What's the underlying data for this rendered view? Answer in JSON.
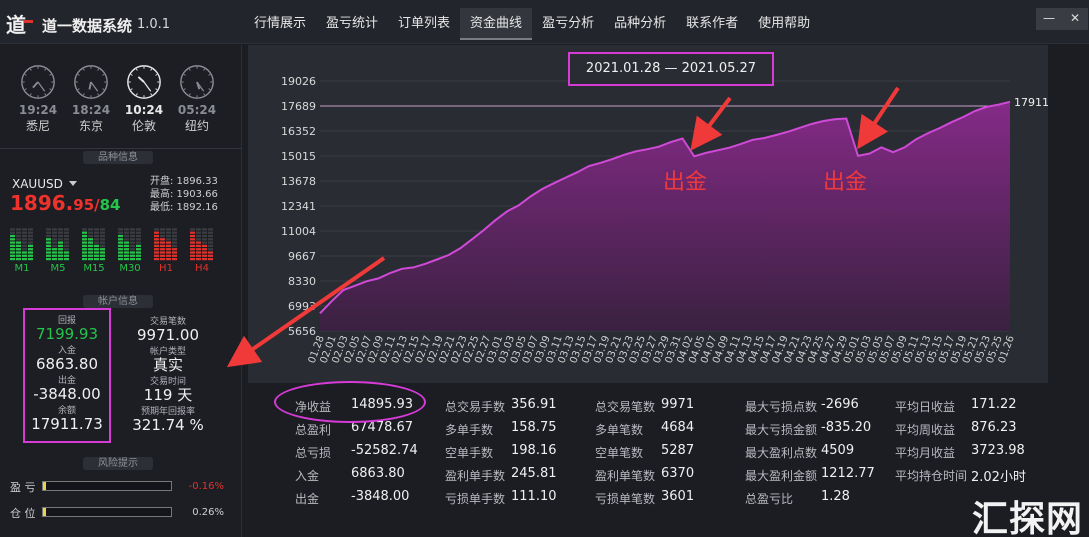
{
  "app": {
    "title": "道一数据系统",
    "version": "1.0.1"
  },
  "tabs": [
    {
      "label": "行情展示",
      "active": false
    },
    {
      "label": "盈亏统计",
      "active": false
    },
    {
      "label": "订单列表",
      "active": false
    },
    {
      "label": "资金曲线",
      "active": true
    },
    {
      "label": "盈亏分析",
      "active": false
    },
    {
      "label": "品种分析",
      "active": false
    },
    {
      "label": "联系作者",
      "active": false
    },
    {
      "label": "使用帮助",
      "active": false
    }
  ],
  "window": {
    "minimize": "—",
    "close": "✕"
  },
  "clocks": [
    {
      "time": "19:24",
      "city": "悉尼",
      "active": false,
      "hour": 19,
      "minute": 24
    },
    {
      "time": "18:24",
      "city": "东京",
      "active": false,
      "hour": 18,
      "minute": 24
    },
    {
      "time": "10:24",
      "city": "伦敦",
      "active": true,
      "hour": 10,
      "minute": 24
    },
    {
      "time": "05:24",
      "city": "纽约",
      "active": false,
      "hour": 5,
      "minute": 24
    }
  ],
  "symbol_info": {
    "section": "品种信息",
    "symbol": "XAUUSD",
    "price_int": "1896.",
    "price_dec": "95",
    "sep": "/",
    "price_sub": "84",
    "open": "开盘: 1896.33",
    "high": "最高: 1903.66",
    "low": "最低: 1892.16",
    "timeframes": [
      {
        "label": "M1",
        "color": "#25c44a",
        "levels": [
          0.8,
          0.55,
          0.3,
          0.45
        ]
      },
      {
        "label": "M5",
        "color": "#25c44a",
        "levels": [
          0.7,
          0.4,
          0.6,
          0.25
        ]
      },
      {
        "label": "M15",
        "color": "#25c44a",
        "levels": [
          0.85,
          0.65,
          0.5,
          0.35
        ]
      },
      {
        "label": "M30",
        "color": "#25c44a",
        "levels": [
          0.75,
          0.6,
          0.3,
          0.5
        ]
      },
      {
        "label": "H1",
        "color": "#e0322c",
        "levels": [
          0.9,
          0.7,
          0.55,
          0.4
        ]
      },
      {
        "label": "H4",
        "color": "#e0322c",
        "levels": [
          0.85,
          0.6,
          0.45,
          0.3
        ]
      }
    ]
  },
  "account": {
    "section": "帐户信息",
    "return_label": "回报",
    "return_value": "7199.93",
    "deposit_label": "入金",
    "deposit_value": "6863.80",
    "withdraw_label": "出金",
    "withdraw_value": "-3848.00",
    "balance_label": "余额",
    "balance_value": "17911.73",
    "trades_label": "交易笔数",
    "trades_value": "9971.00",
    "type_label": "帐户类型",
    "type_value": "真实",
    "time_label": "交易时间",
    "time_value": "119 天",
    "annual_label": "预期年回报率",
    "annual_value": "321.74 %"
  },
  "risk": {
    "section": "风险提示",
    "pl_label": "盈  亏",
    "pl_value": "-0.16%",
    "pos_label": "仓  位",
    "pos_value": "0.26%",
    "pos_fill": 0.0026
  },
  "chart_data": {
    "type": "area",
    "title": "2021.01.28 — 2021.05.27",
    "y_ticks": [
      "19026",
      "17689",
      "16352",
      "15015",
      "13678",
      "12341",
      "11004",
      "9667",
      "8330",
      "6993",
      "5656"
    ],
    "ylim": [
      5656,
      19026
    ],
    "x_ticks": [
      "01.28",
      "02.01",
      "02.03",
      "02.05",
      "02.07",
      "02.09",
      "02.11",
      "02.13",
      "02.15",
      "02.17",
      "02.19",
      "02.21",
      "02.23",
      "02.25",
      "02.27",
      "03.01",
      "03.03",
      "03.05",
      "03.07",
      "03.09",
      "03.11",
      "03.13",
      "03.15",
      "03.17",
      "03.19",
      "03.21",
      "03.23",
      "03.25",
      "03.27",
      "03.29",
      "03.31",
      "04.02",
      "04.05",
      "04.07",
      "04.09",
      "04.11",
      "04.13",
      "04.15",
      "04.17",
      "04.19",
      "04.21",
      "04.23",
      "04.25",
      "04.27",
      "04.29",
      "05.01",
      "05.03",
      "05.05",
      "05.07",
      "05.09",
      "05.11",
      "05.13",
      "05.15",
      "05.17",
      "05.19",
      "05.21",
      "05.23",
      "05.25",
      "01.26"
    ],
    "last_value_label": "17911.73",
    "reference_line": 17689,
    "values": [
      6600,
      7250,
      7850,
      8080,
      8320,
      8470,
      8760,
      8980,
      9060,
      9250,
      9480,
      9720,
      10080,
      10560,
      11050,
      11580,
      12050,
      12380,
      12850,
      13250,
      13560,
      13860,
      14150,
      14480,
      14650,
      14850,
      15080,
      15260,
      15380,
      15520,
      15760,
      15950,
      15000,
      15180,
      15320,
      15460,
      15660,
      15880,
      15980,
      16140,
      16310,
      16520,
      16720,
      16880,
      16980,
      17020,
      15020,
      15150,
      15480,
      15220,
      15480,
      15920,
      16240,
      16510,
      16820,
      17100,
      17420,
      17640,
      17760,
      17911
    ],
    "annotations": [
      "出金",
      "出金"
    ]
  },
  "stats": [
    [
      {
        "k": "净收益",
        "v": "14895.93"
      },
      {
        "k": "总盈利",
        "v": "67478.67"
      },
      {
        "k": "总亏损",
        "v": "-52582.74"
      },
      {
        "k": "入金",
        "v": "6863.80"
      },
      {
        "k": "出金",
        "v": "-3848.00"
      }
    ],
    [
      {
        "k": "总交易手数",
        "v": "356.91"
      },
      {
        "k": "多单手数",
        "v": "158.75"
      },
      {
        "k": "空单手数",
        "v": "198.16"
      },
      {
        "k": "盈利单手数",
        "v": "245.81"
      },
      {
        "k": "亏损单手数",
        "v": "111.10"
      }
    ],
    [
      {
        "k": "总交易笔数",
        "v": "9971"
      },
      {
        "k": "多单笔数",
        "v": "4684"
      },
      {
        "k": "空单笔数",
        "v": "5287"
      },
      {
        "k": "盈利单笔数",
        "v": "6370"
      },
      {
        "k": "亏损单笔数",
        "v": "3601"
      }
    ],
    [
      {
        "k": "最大亏损点数",
        "v": "-2696"
      },
      {
        "k": "最大亏损金额",
        "v": "-835.20"
      },
      {
        "k": "最大盈利点数",
        "v": "4509"
      },
      {
        "k": "最大盈利金额",
        "v": "1212.77"
      },
      {
        "k": "总盈亏比",
        "v": "1.28"
      }
    ],
    [
      {
        "k": "平均日收益",
        "v": "171.22"
      },
      {
        "k": "平均周收益",
        "v": "876.23"
      },
      {
        "k": "平均月收益",
        "v": "3723.98"
      },
      {
        "k": "平均持仓时间",
        "v": "2.02小时"
      }
    ]
  ],
  "watermark": "汇探网",
  "colors": {
    "accent": "#d63bd8",
    "up": "#25c44a",
    "down": "#e0322c",
    "annotation": "#f03a3a"
  }
}
